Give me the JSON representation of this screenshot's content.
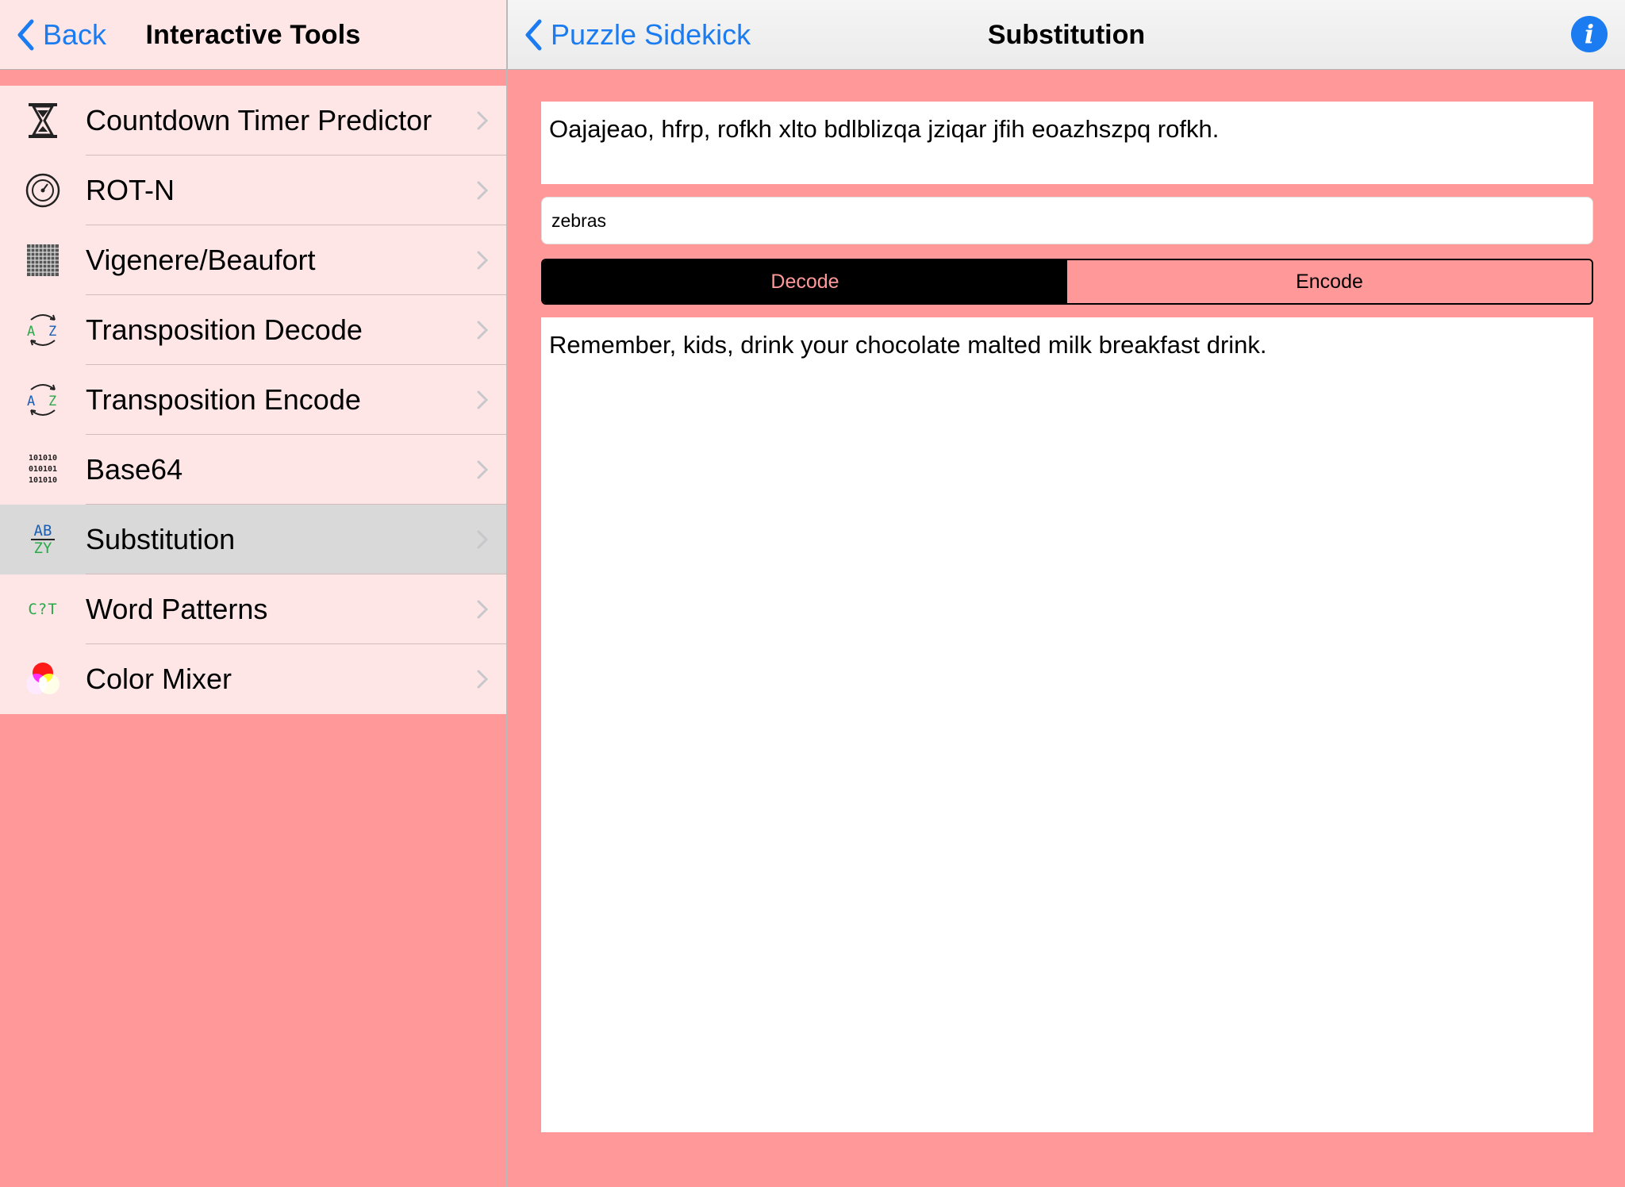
{
  "sidebar": {
    "back_label": "Back",
    "title": "Interactive Tools",
    "items": [
      {
        "label": "Countdown Timer Predictor",
        "icon": "hourglass-icon"
      },
      {
        "label": "ROT-N",
        "icon": "dial-icon"
      },
      {
        "label": "Vigenere/Beaufort",
        "icon": "grid-icon"
      },
      {
        "label": "Transposition Decode",
        "icon": "swap-az-icon"
      },
      {
        "label": "Transposition Encode",
        "icon": "swap-az-icon"
      },
      {
        "label": "Base64",
        "icon": "binary-icon",
        "icon_lines": [
          "101010",
          "010101",
          "101010"
        ]
      },
      {
        "label": "Substitution",
        "icon": "substitution-icon",
        "icon_top": "AB",
        "icon_bottom": "ZY",
        "selected": true
      },
      {
        "label": "Word Patterns",
        "icon": "word-pattern-icon",
        "icon_text": "C?T"
      },
      {
        "label": "Color Mixer",
        "icon": "color-mixer-icon"
      }
    ]
  },
  "detail": {
    "back_label": "Puzzle Sidekick",
    "title": "Substitution",
    "cipher_text": "Oajajeao, hfrp, rofkh xlto bdlblizqa jziqar jfih eoazhszpq rofkh.",
    "key_value": "zebras",
    "mode": {
      "decode_label": "Decode",
      "encode_label": "Encode",
      "selected": "Decode"
    },
    "plain_text": "Remember, kids, drink your chocolate malted milk breakfast drink."
  },
  "colors": {
    "background": "#ff9999",
    "list_background": "#ffe6e6",
    "selected_row": "#d9d9d9",
    "accent": "#1a7cf0",
    "segment_active": "#000000"
  }
}
